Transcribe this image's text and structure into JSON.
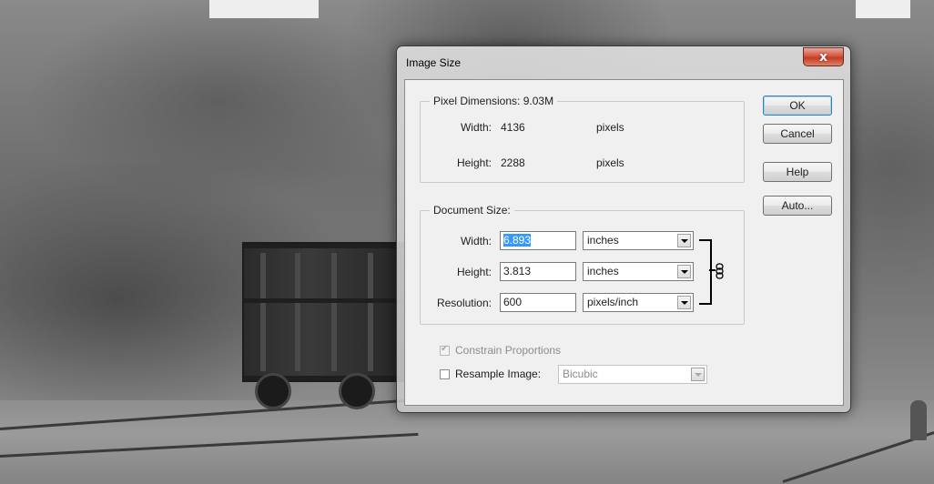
{
  "dialog": {
    "title": "Image Size",
    "close_glyph": "x",
    "pixel_dimensions": {
      "legend": "Pixel Dimensions:",
      "size": "9.03M",
      "width_label": "Width:",
      "width_value": "4136",
      "width_unit": "pixels",
      "height_label": "Height:",
      "height_value": "2288",
      "height_unit": "pixels"
    },
    "document_size": {
      "legend": "Document Size:",
      "width_label": "Width:",
      "width_value": "6.893",
      "width_unit": "inches",
      "height_label": "Height:",
      "height_value": "3.813",
      "height_unit": "inches",
      "resolution_label": "Resolution:",
      "resolution_value": "600",
      "resolution_unit": "pixels/inch"
    },
    "options": {
      "constrain_label": "Constrain Proportions",
      "constrain_checked": true,
      "resample_label": "Resample Image:",
      "resample_checked": false,
      "resample_method": "Bicubic"
    },
    "buttons": {
      "ok": "OK",
      "cancel": "Cancel",
      "help": "Help",
      "auto": "Auto..."
    }
  },
  "icons": {
    "close": "close-icon",
    "link": "chain-link-icon",
    "dropdown": "chevron-down-icon",
    "checkbox": "checkmark-icon"
  }
}
